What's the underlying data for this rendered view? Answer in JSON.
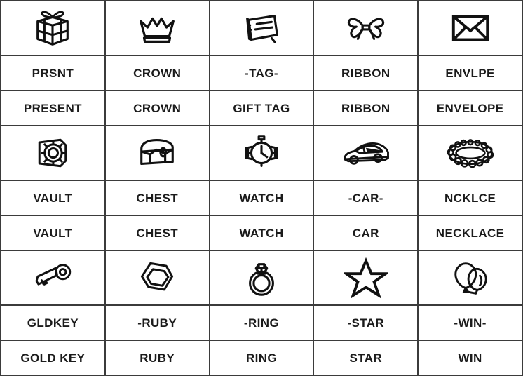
{
  "sheet": {
    "title": "Icon Abbreviation Reference Grid",
    "columns": 5,
    "rows": 9,
    "border_color": "#3b3b3b",
    "text_color": "#1b1b1b",
    "background_color": "#ffffff"
  },
  "blocks": [
    {
      "icons": [
        "present-icon",
        "crown-icon",
        "gift-tag-icon",
        "ribbon-icon",
        "envelope-icon"
      ],
      "abbreviations": [
        "PRSNT",
        "CROWN",
        "-TAG-",
        "RIBBON",
        "ENVLPE"
      ],
      "words": [
        "PRESENT",
        "CROWN",
        "GIFT TAG",
        "RIBBON",
        "ENVELOPE"
      ]
    },
    {
      "icons": [
        "vault-icon",
        "treasure-chest-icon",
        "watch-icon",
        "car-icon",
        "necklace-icon"
      ],
      "abbreviations": [
        "VAULT",
        "CHEST",
        "WATCH",
        "-CAR-",
        "NCKLCE"
      ],
      "words": [
        "VAULT",
        "CHEST",
        "WATCH",
        "CAR",
        "NECKLACE"
      ]
    },
    {
      "icons": [
        "gold-key-icon",
        "ruby-gem-icon",
        "diamond-ring-icon",
        "star-icon",
        "balloons-icon"
      ],
      "abbreviations": [
        "GLDKEY",
        "-RUBY",
        "-RING",
        "-STAR",
        "-WIN-"
      ],
      "words": [
        "GOLD KEY",
        "RUBY",
        "RING",
        "STAR",
        "WIN"
      ]
    }
  ]
}
